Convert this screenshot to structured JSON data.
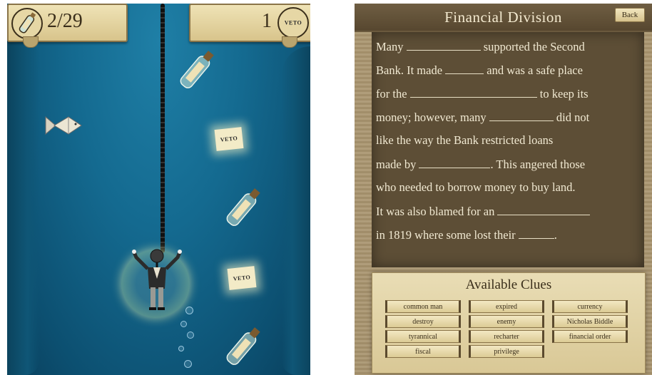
{
  "game": {
    "bottles_counter": "2/29",
    "veto_counter": "1",
    "veto_label": "VETO",
    "colors": {
      "water": "#146a90",
      "banner": "#e6d7a5"
    }
  },
  "quiz": {
    "title": "Financial Division",
    "back_label": "Back",
    "passage": {
      "l1a": "Many",
      "l1b": "supported the Second",
      "l2a": "Bank.  It made",
      "l2b": "and was a safe place",
      "l3a": "for the",
      "l3b": "to keep its",
      "l4a": "money; however, many",
      "l4b": "did not",
      "l5": "like the way the Bank restricted loans",
      "l6a": "made by",
      "l6b": ".  This angered those",
      "l7": "who needed to borrow money to buy land.",
      "l8": "It was also blamed for an",
      "l9a": "in 1819 where some lost their",
      "l9b": "."
    },
    "clues_title": "Available Clues",
    "clues": [
      "common man",
      "expired",
      "currency",
      "destroy",
      "enemy",
      "Nicholas Biddle",
      "tyrannical",
      "recharter",
      "financial order",
      "fiscal",
      "privilege"
    ]
  }
}
